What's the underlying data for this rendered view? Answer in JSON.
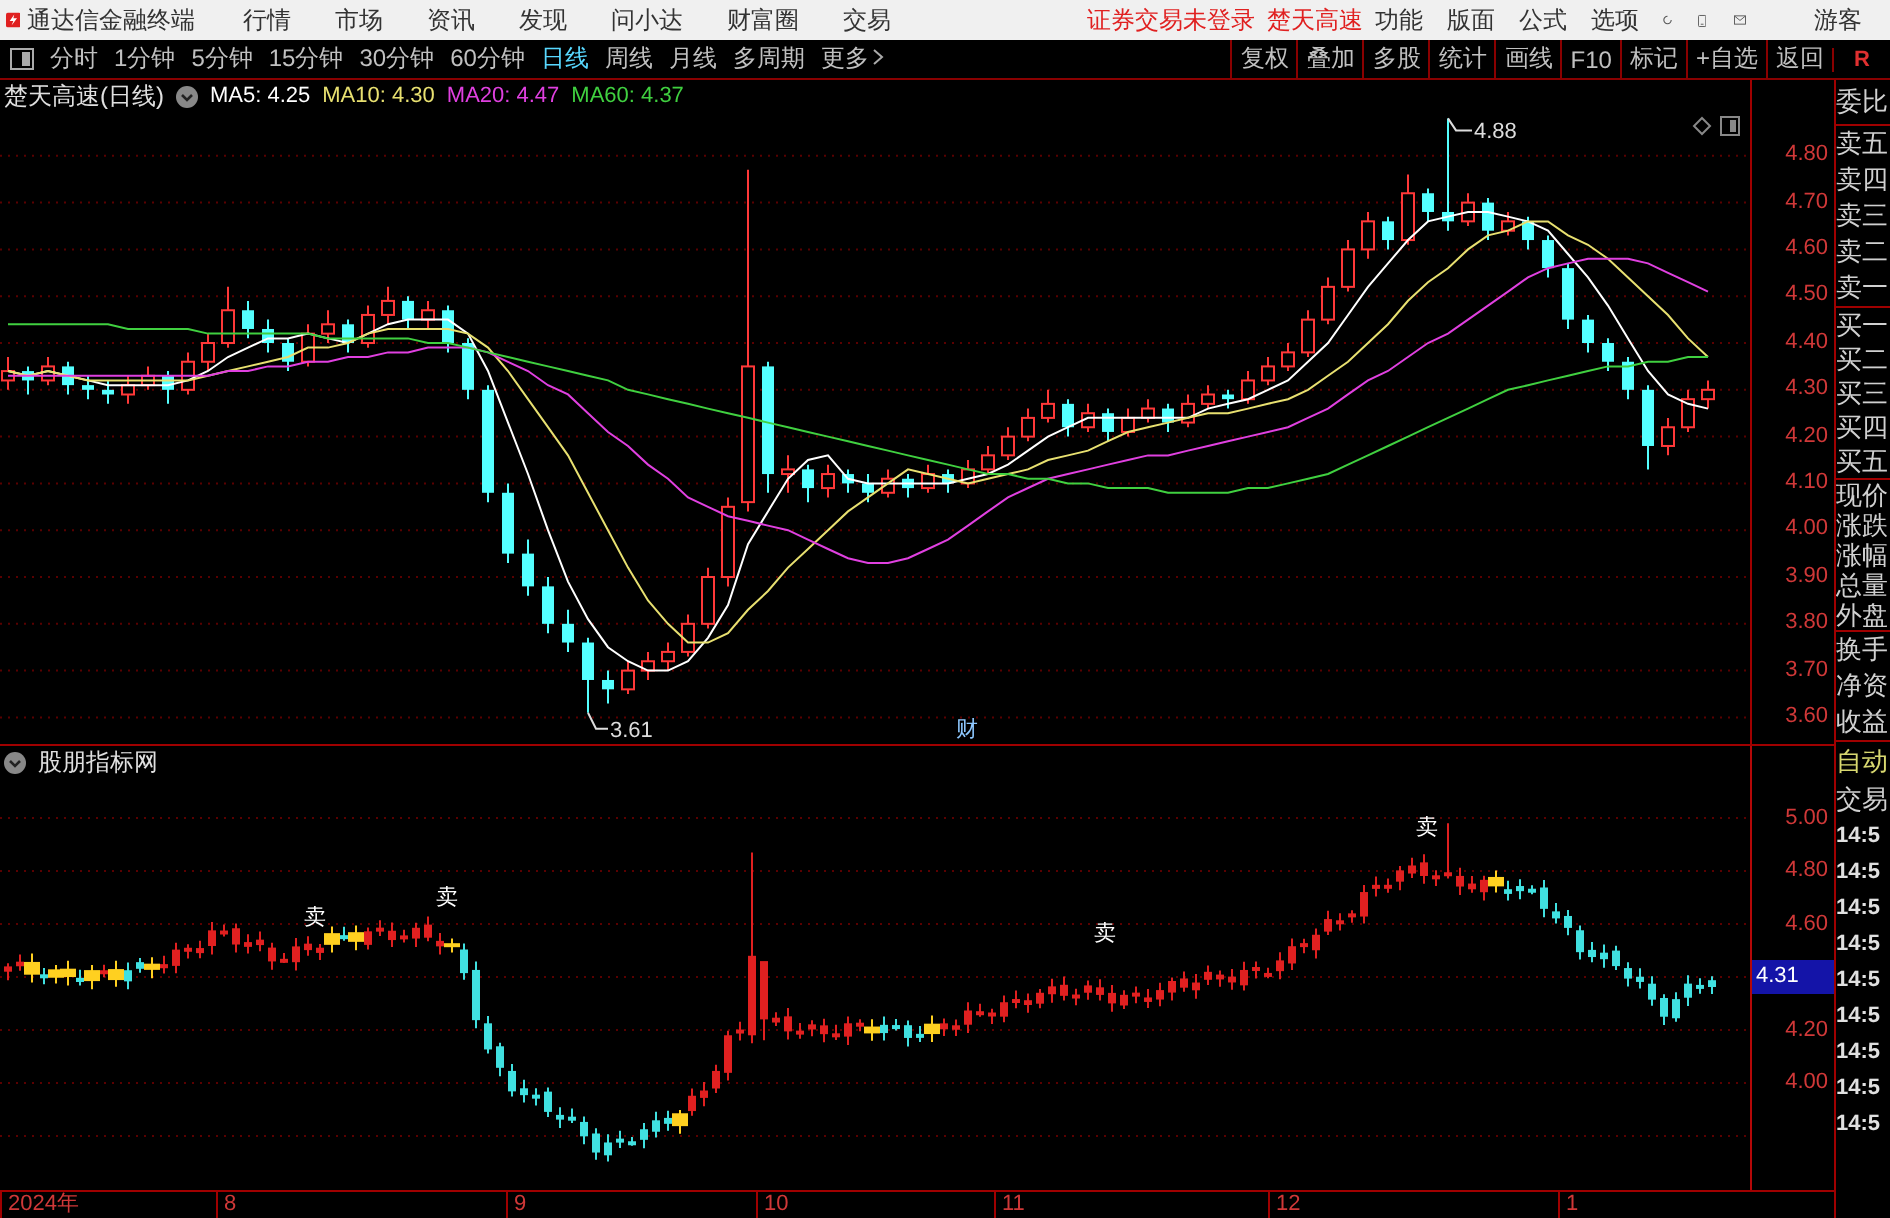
{
  "menubar": {
    "app_name": "通达信金融终端",
    "menus": [
      "行情",
      "市场",
      "资讯",
      "发现",
      "问小达",
      "财富圈",
      "交易"
    ],
    "notices": [
      "证券交易未登录",
      "楚天高速"
    ],
    "right_menus": [
      "功能",
      "版面",
      "公式",
      "选项"
    ],
    "user": "游客"
  },
  "toolbar": {
    "periods": [
      {
        "label": "分时",
        "selected": false
      },
      {
        "label": "1分钟",
        "selected": false
      },
      {
        "label": "5分钟",
        "selected": false
      },
      {
        "label": "15分钟",
        "selected": false
      },
      {
        "label": "30分钟",
        "selected": false
      },
      {
        "label": "60分钟",
        "selected": false
      },
      {
        "label": "日线",
        "selected": true
      },
      {
        "label": "周线",
        "selected": false
      },
      {
        "label": "月线",
        "selected": false
      },
      {
        "label": "多周期",
        "selected": false
      },
      {
        "label": "更多",
        "selected": false
      }
    ],
    "buttons": [
      "复权",
      "叠加",
      "多股",
      "统计",
      "画线",
      "F10",
      "标记",
      "+自选",
      "返回"
    ],
    "corner": "R"
  },
  "main_chart": {
    "title": "楚天高速(日线)",
    "ma_readings": [
      ": 4.25",
      ": 4.30",
      ": 4.47",
      ": 4.37"
    ],
    "chart_data": {
      "type": "candlestick",
      "ylim": [
        3.543,
        4.962
      ],
      "grid": true,
      "yticks": [
        {
          "value": 4.8,
          "label": "4.80"
        },
        {
          "value": 4.7,
          "label": "4.70"
        },
        {
          "value": 4.6,
          "label": "4.60"
        },
        {
          "value": 4.5,
          "label": "4.50"
        },
        {
          "value": 4.4,
          "label": "4.40"
        },
        {
          "value": 4.3,
          "label": "4.30"
        },
        {
          "value": 4.2,
          "label": "4.20"
        },
        {
          "value": 4.1,
          "label": "4.10"
        },
        {
          "value": 4.0,
          "label": "4.00"
        },
        {
          "value": 3.9,
          "label": "3.90"
        },
        {
          "value": 3.8,
          "label": "3.80"
        },
        {
          "value": 3.7,
          "label": "3.70"
        },
        {
          "value": 3.6,
          "label": "3.60"
        }
      ],
      "ohlc": [
        [
          4.32,
          4.37,
          4.3,
          4.34
        ],
        [
          4.34,
          4.35,
          4.29,
          4.32
        ],
        [
          4.32,
          4.37,
          4.31,
          4.35
        ],
        [
          4.35,
          4.36,
          4.29,
          4.31
        ],
        [
          4.31,
          4.33,
          4.28,
          4.3
        ],
        [
          4.3,
          4.32,
          4.27,
          4.29
        ],
        [
          4.29,
          4.33,
          4.27,
          4.31
        ],
        [
          4.31,
          4.35,
          4.3,
          4.33
        ],
        [
          4.33,
          4.34,
          4.27,
          4.3
        ],
        [
          4.3,
          4.38,
          4.29,
          4.36
        ],
        [
          4.36,
          4.42,
          4.34,
          4.4
        ],
        [
          4.4,
          4.52,
          4.39,
          4.47
        ],
        [
          4.47,
          4.49,
          4.41,
          4.43
        ],
        [
          4.43,
          4.45,
          4.38,
          4.4
        ],
        [
          4.4,
          4.41,
          4.34,
          4.36
        ],
        [
          4.36,
          4.44,
          4.35,
          4.42
        ],
        [
          4.42,
          4.47,
          4.4,
          4.44
        ],
        [
          4.44,
          4.45,
          4.38,
          4.4
        ],
        [
          4.4,
          4.48,
          4.39,
          4.46
        ],
        [
          4.46,
          4.52,
          4.44,
          4.49
        ],
        [
          4.49,
          4.5,
          4.43,
          4.45
        ],
        [
          4.45,
          4.49,
          4.43,
          4.47
        ],
        [
          4.47,
          4.48,
          4.38,
          4.4
        ],
        [
          4.4,
          4.41,
          4.28,
          4.3
        ],
        [
          4.3,
          4.31,
          4.06,
          4.08
        ],
        [
          4.08,
          4.1,
          3.93,
          3.95
        ],
        [
          3.95,
          3.98,
          3.86,
          3.88
        ],
        [
          3.88,
          3.9,
          3.78,
          3.8
        ],
        [
          3.8,
          3.83,
          3.74,
          3.76
        ],
        [
          3.76,
          3.77,
          3.61,
          3.68
        ],
        [
          3.68,
          3.7,
          3.63,
          3.66
        ],
        [
          3.66,
          3.72,
          3.65,
          3.7
        ],
        [
          3.7,
          3.74,
          3.68,
          3.72
        ],
        [
          3.72,
          3.76,
          3.7,
          3.74
        ],
        [
          3.74,
          3.82,
          3.73,
          3.8
        ],
        [
          3.8,
          3.92,
          3.79,
          3.9
        ],
        [
          3.9,
          4.07,
          3.88,
          4.05
        ],
        [
          4.06,
          4.77,
          4.04,
          4.35
        ],
        [
          4.35,
          4.36,
          4.08,
          4.12
        ],
        [
          4.12,
          4.16,
          4.08,
          4.13
        ],
        [
          4.13,
          4.14,
          4.06,
          4.09
        ],
        [
          4.09,
          4.14,
          4.07,
          4.12
        ],
        [
          4.12,
          4.13,
          4.08,
          4.1
        ],
        [
          4.1,
          4.12,
          4.06,
          4.08
        ],
        [
          4.08,
          4.13,
          4.07,
          4.11
        ],
        [
          4.11,
          4.12,
          4.07,
          4.09
        ],
        [
          4.09,
          4.14,
          4.08,
          4.12
        ],
        [
          4.12,
          4.13,
          4.08,
          4.1
        ],
        [
          4.1,
          4.15,
          4.09,
          4.13
        ],
        [
          4.13,
          4.18,
          4.12,
          4.16
        ],
        [
          4.16,
          4.22,
          4.15,
          4.2
        ],
        [
          4.2,
          4.26,
          4.19,
          4.24
        ],
        [
          4.24,
          4.3,
          4.23,
          4.27
        ],
        [
          4.27,
          4.28,
          4.2,
          4.22
        ],
        [
          4.22,
          4.27,
          4.21,
          4.25
        ],
        [
          4.25,
          4.26,
          4.19,
          4.21
        ],
        [
          4.21,
          4.26,
          4.2,
          4.24
        ],
        [
          4.24,
          4.28,
          4.23,
          4.26
        ],
        [
          4.26,
          4.27,
          4.21,
          4.23
        ],
        [
          4.23,
          4.29,
          4.22,
          4.27
        ],
        [
          4.27,
          4.31,
          4.26,
          4.29
        ],
        [
          4.29,
          4.3,
          4.26,
          4.28
        ],
        [
          4.28,
          4.34,
          4.27,
          4.32
        ],
        [
          4.32,
          4.37,
          4.31,
          4.35
        ],
        [
          4.35,
          4.4,
          4.34,
          4.38
        ],
        [
          4.38,
          4.47,
          4.37,
          4.45
        ],
        [
          4.45,
          4.54,
          4.44,
          4.52
        ],
        [
          4.52,
          4.62,
          4.51,
          4.6
        ],
        [
          4.6,
          4.68,
          4.58,
          4.66
        ],
        [
          4.66,
          4.67,
          4.6,
          4.62
        ],
        [
          4.62,
          4.76,
          4.61,
          4.72
        ],
        [
          4.72,
          4.73,
          4.66,
          4.68
        ],
        [
          4.68,
          4.88,
          4.64,
          4.66
        ],
        [
          4.66,
          4.72,
          4.65,
          4.7
        ],
        [
          4.7,
          4.71,
          4.62,
          4.64
        ],
        [
          4.64,
          4.68,
          4.63,
          4.66
        ],
        [
          4.66,
          4.67,
          4.6,
          4.62
        ],
        [
          4.62,
          4.63,
          4.54,
          4.56
        ],
        [
          4.56,
          4.57,
          4.43,
          4.45
        ],
        [
          4.45,
          4.46,
          4.38,
          4.4
        ],
        [
          4.4,
          4.41,
          4.34,
          4.36
        ],
        [
          4.36,
          4.37,
          4.28,
          4.3
        ],
        [
          4.3,
          4.31,
          4.13,
          4.18
        ],
        [
          4.18,
          4.24,
          4.16,
          4.22
        ],
        [
          4.22,
          4.3,
          4.21,
          4.28
        ],
        [
          4.28,
          4.32,
          4.26,
          4.3
        ]
      ],
      "series": [
        {
          "name": "MA5",
          "type": "line",
          "color": "#ffffff",
          "values": [
            4.34,
            4.33,
            4.34,
            4.33,
            4.32,
            4.31,
            4.31,
            4.31,
            4.31,
            4.32,
            4.34,
            4.37,
            4.39,
            4.41,
            4.41,
            4.42,
            4.41,
            4.4,
            4.42,
            4.44,
            4.45,
            4.45,
            4.45,
            4.42,
            4.34,
            4.23,
            4.12,
            4.0,
            3.89,
            3.81,
            3.75,
            3.72,
            3.7,
            3.7,
            3.72,
            3.77,
            3.84,
            3.97,
            4.04,
            4.11,
            4.15,
            4.16,
            4.11,
            4.1,
            4.1,
            4.1,
            4.1,
            4.1,
            4.11,
            4.12,
            4.14,
            4.17,
            4.2,
            4.22,
            4.24,
            4.24,
            4.24,
            4.24,
            4.24,
            4.24,
            4.26,
            4.27,
            4.28,
            4.3,
            4.32,
            4.36,
            4.4,
            4.46,
            4.52,
            4.57,
            4.62,
            4.66,
            4.67,
            4.68,
            4.68,
            4.67,
            4.66,
            4.64,
            4.59,
            4.54,
            4.48,
            4.41,
            4.34,
            4.29,
            4.27,
            4.26
          ]
        },
        {
          "name": "MA10",
          "type": "line",
          "color": "#e8e070",
          "values": [
            4.34,
            4.33,
            4.34,
            4.33,
            4.32,
            4.32,
            4.32,
            4.32,
            4.32,
            4.32,
            4.33,
            4.34,
            4.35,
            4.36,
            4.37,
            4.39,
            4.39,
            4.4,
            4.42,
            4.43,
            4.43,
            4.43,
            4.43,
            4.42,
            4.39,
            4.34,
            4.28,
            4.22,
            4.16,
            4.08,
            4.0,
            3.92,
            3.85,
            3.8,
            3.76,
            3.76,
            3.78,
            3.83,
            3.87,
            3.92,
            3.96,
            4.0,
            4.04,
            4.07,
            4.1,
            4.13,
            4.12,
            4.11,
            4.1,
            4.11,
            4.12,
            4.13,
            4.15,
            4.16,
            4.17,
            4.19,
            4.21,
            4.22,
            4.23,
            4.24,
            4.25,
            4.25,
            4.26,
            4.27,
            4.28,
            4.3,
            4.33,
            4.36,
            4.4,
            4.44,
            4.49,
            4.53,
            4.56,
            4.6,
            4.63,
            4.64,
            4.66,
            4.66,
            4.63,
            4.61,
            4.58,
            4.54,
            4.5,
            4.46,
            4.41,
            4.37
          ]
        },
        {
          "name": "MA20",
          "type": "line",
          "color": "#e040e0",
          "values": [
            4.33,
            4.33,
            4.33,
            4.33,
            4.33,
            4.33,
            4.33,
            4.33,
            4.33,
            4.33,
            4.33,
            4.34,
            4.34,
            4.35,
            4.35,
            4.36,
            4.36,
            4.37,
            4.37,
            4.38,
            4.38,
            4.39,
            4.39,
            4.39,
            4.38,
            4.36,
            4.34,
            4.31,
            4.29,
            4.25,
            4.21,
            4.18,
            4.14,
            4.11,
            4.07,
            4.05,
            4.03,
            4.02,
            4.01,
            4.0,
            3.98,
            3.96,
            3.94,
            3.93,
            3.93,
            3.94,
            3.96,
            3.98,
            4.01,
            4.04,
            4.07,
            4.09,
            4.11,
            4.12,
            4.13,
            4.14,
            4.15,
            4.16,
            4.16,
            4.17,
            4.18,
            4.19,
            4.2,
            4.21,
            4.22,
            4.24,
            4.26,
            4.29,
            4.32,
            4.34,
            4.37,
            4.4,
            4.42,
            4.45,
            4.48,
            4.51,
            4.54,
            4.56,
            4.57,
            4.58,
            4.58,
            4.58,
            4.57,
            4.55,
            4.53,
            4.51
          ]
        },
        {
          "name": "MA60",
          "type": "line",
          "color": "#40d040",
          "values": [
            4.44,
            4.44,
            4.44,
            4.44,
            4.44,
            4.44,
            4.43,
            4.43,
            4.43,
            4.43,
            4.42,
            4.42,
            4.42,
            4.42,
            4.42,
            4.42,
            4.41,
            4.41,
            4.41,
            4.41,
            4.41,
            4.4,
            4.4,
            4.39,
            4.38,
            4.37,
            4.36,
            4.35,
            4.34,
            4.33,
            4.32,
            4.3,
            4.29,
            4.28,
            4.27,
            4.26,
            4.25,
            4.24,
            4.23,
            4.22,
            4.21,
            4.2,
            4.19,
            4.18,
            4.17,
            4.16,
            4.15,
            4.14,
            4.13,
            4.12,
            4.12,
            4.11,
            4.11,
            4.1,
            4.1,
            4.09,
            4.09,
            4.09,
            4.08,
            4.08,
            4.08,
            4.08,
            4.09,
            4.09,
            4.1,
            4.11,
            4.12,
            4.14,
            4.16,
            4.18,
            4.2,
            4.22,
            4.24,
            4.26,
            4.28,
            4.3,
            4.31,
            4.32,
            4.33,
            4.34,
            4.35,
            4.35,
            4.36,
            4.36,
            4.37,
            4.37
          ]
        }
      ]
    },
    "high_label": "4.88",
    "low_label": "3.61",
    "event_marker": "财"
  },
  "indicator": {
    "title": "股朋指标网",
    "signals": [
      "卖",
      "卖",
      "卖",
      "卖"
    ],
    "y_axis": [
      {
        "kind": "tick",
        "label": "5.00"
      },
      {
        "kind": "tick",
        "label": "4.80"
      },
      {
        "kind": "tick",
        "label": "4.60"
      },
      {
        "kind": "current",
        "label": "4.31"
      },
      {
        "kind": "tick",
        "label": "4.20"
      },
      {
        "kind": "tick",
        "label": "4.00"
      }
    ]
  },
  "time_axis": [
    "2024年",
    "8",
    "9",
    "10",
    "11",
    "12",
    "1"
  ],
  "side_panel": {
    "groups": [
      [
        "委比"
      ],
      [
        "卖五",
        "卖四",
        "卖三",
        "卖二",
        "卖一"
      ],
      [
        "买一",
        "买二",
        "买三",
        "买四",
        "买五"
      ],
      [
        "现价",
        "涨跌",
        "涨幅",
        "总量",
        "外盘"
      ],
      [
        "换手",
        "净资",
        "收益"
      ]
    ],
    "auto": "自动",
    "trade": "交易",
    "trade_times": [
      "14:5",
      "14:5",
      "14:5",
      "14:5",
      "14:5",
      "14:5",
      "14:5",
      "14:5",
      "14:5"
    ]
  }
}
